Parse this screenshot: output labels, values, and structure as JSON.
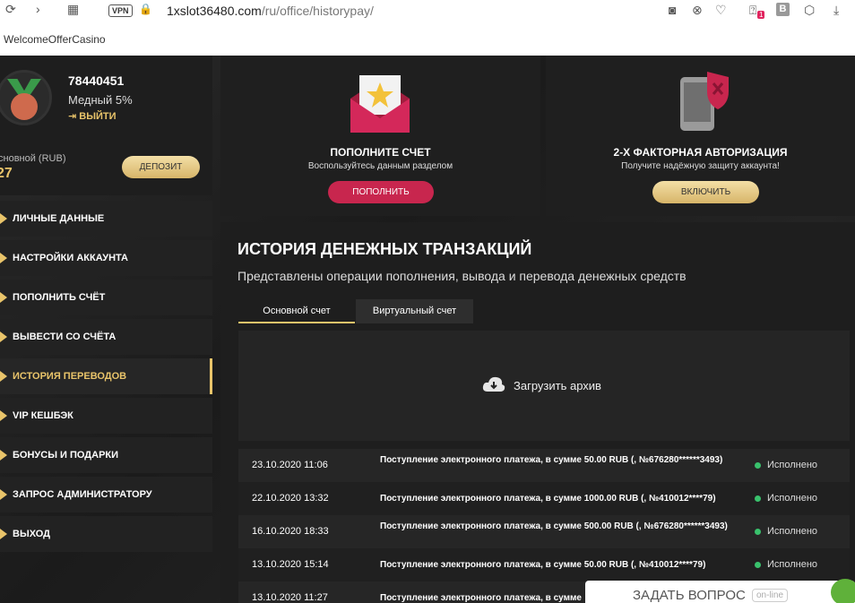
{
  "browser": {
    "vpn": "VPN",
    "url_host": "1xslot36480.com",
    "url_path": "/ru/office/historypay/",
    "ext_badge": "1",
    "b_ext": "B",
    "bookmark": "WelcomeOfferCasino"
  },
  "profile": {
    "user_id": "78440451",
    "level": "Медный 5%",
    "logout": "ВЫЙТИ",
    "balance_label": "сновной (RUB)",
    "balance_value": "27",
    "deposit": "ДЕПОЗИТ"
  },
  "sidebar": {
    "items": [
      {
        "label": "ЛИЧНЫЕ ДАННЫЕ"
      },
      {
        "label": "НАСТРОЙКИ АККАУНТА"
      },
      {
        "label": "ПОПОЛНИТЬ СЧЁТ"
      },
      {
        "label": "ВЫВЕСТИ СО СЧЁТА"
      },
      {
        "label": "ИСТОРИЯ ПЕРЕВОДОВ"
      },
      {
        "label": "VIP КЕШБЭК"
      },
      {
        "label": "БОНУСЫ И ПОДАРКИ"
      },
      {
        "label": "ЗАПРОС АДМИНИСТРАТОРУ"
      },
      {
        "label": "ВЫХОД"
      }
    ],
    "active_index": 4
  },
  "cards": {
    "deposit": {
      "title": "ПОПОЛНИТЕ СЧЕТ",
      "subtitle": "Воспользуйтесь данным разделом",
      "button": "ПОПОЛНИТЬ"
    },
    "twofa": {
      "title": "2-Х ФАКТОРНАЯ АВТОРИЗАЦИЯ",
      "subtitle": "Получите надёжную защиту аккаунта!",
      "button": "ВКЛЮЧИТЬ"
    }
  },
  "history": {
    "title": "ИСТОРИЯ ДЕНЕЖНЫХ ТРАНЗАКЦИЙ",
    "subtitle": "Представлены операции пополнения, вывода и перевода денежных средств",
    "tabs": [
      "Основной счет",
      "Виртуальный счет"
    ],
    "upload": "Загрузить архив",
    "transactions": [
      {
        "date": "23.10.2020 11:06",
        "desc": "Поступление электронного платежа, в сумме 50.00 RUB (, №676280******3493)",
        "status": "Исполнено"
      },
      {
        "date": "22.10.2020 13:32",
        "desc": "Поступление электронного платежа, в сумме 1000.00 RUB (, №410012****79)",
        "status": "Исполнено"
      },
      {
        "date": "16.10.2020 18:33",
        "desc": "Поступление электронного платежа, в сумме 500.00 RUB (, №676280******3493)",
        "status": "Исполнено"
      },
      {
        "date": "13.10.2020 15:14",
        "desc": "Поступление электронного платежа, в сумме 50.00 RUB (, №410012****79)",
        "status": "Исполнено"
      },
      {
        "date": "13.10.2020 11:27",
        "desc": "Поступление электронного платежа, в сумме",
        "status": ""
      }
    ]
  },
  "ask": {
    "label": "ЗАДАТЬ ВОПРОС",
    "online": "on-line"
  },
  "colors": {
    "accent_gold": "#e9c46a",
    "accent_pink": "#c8264e",
    "status_green": "#39c16c"
  }
}
